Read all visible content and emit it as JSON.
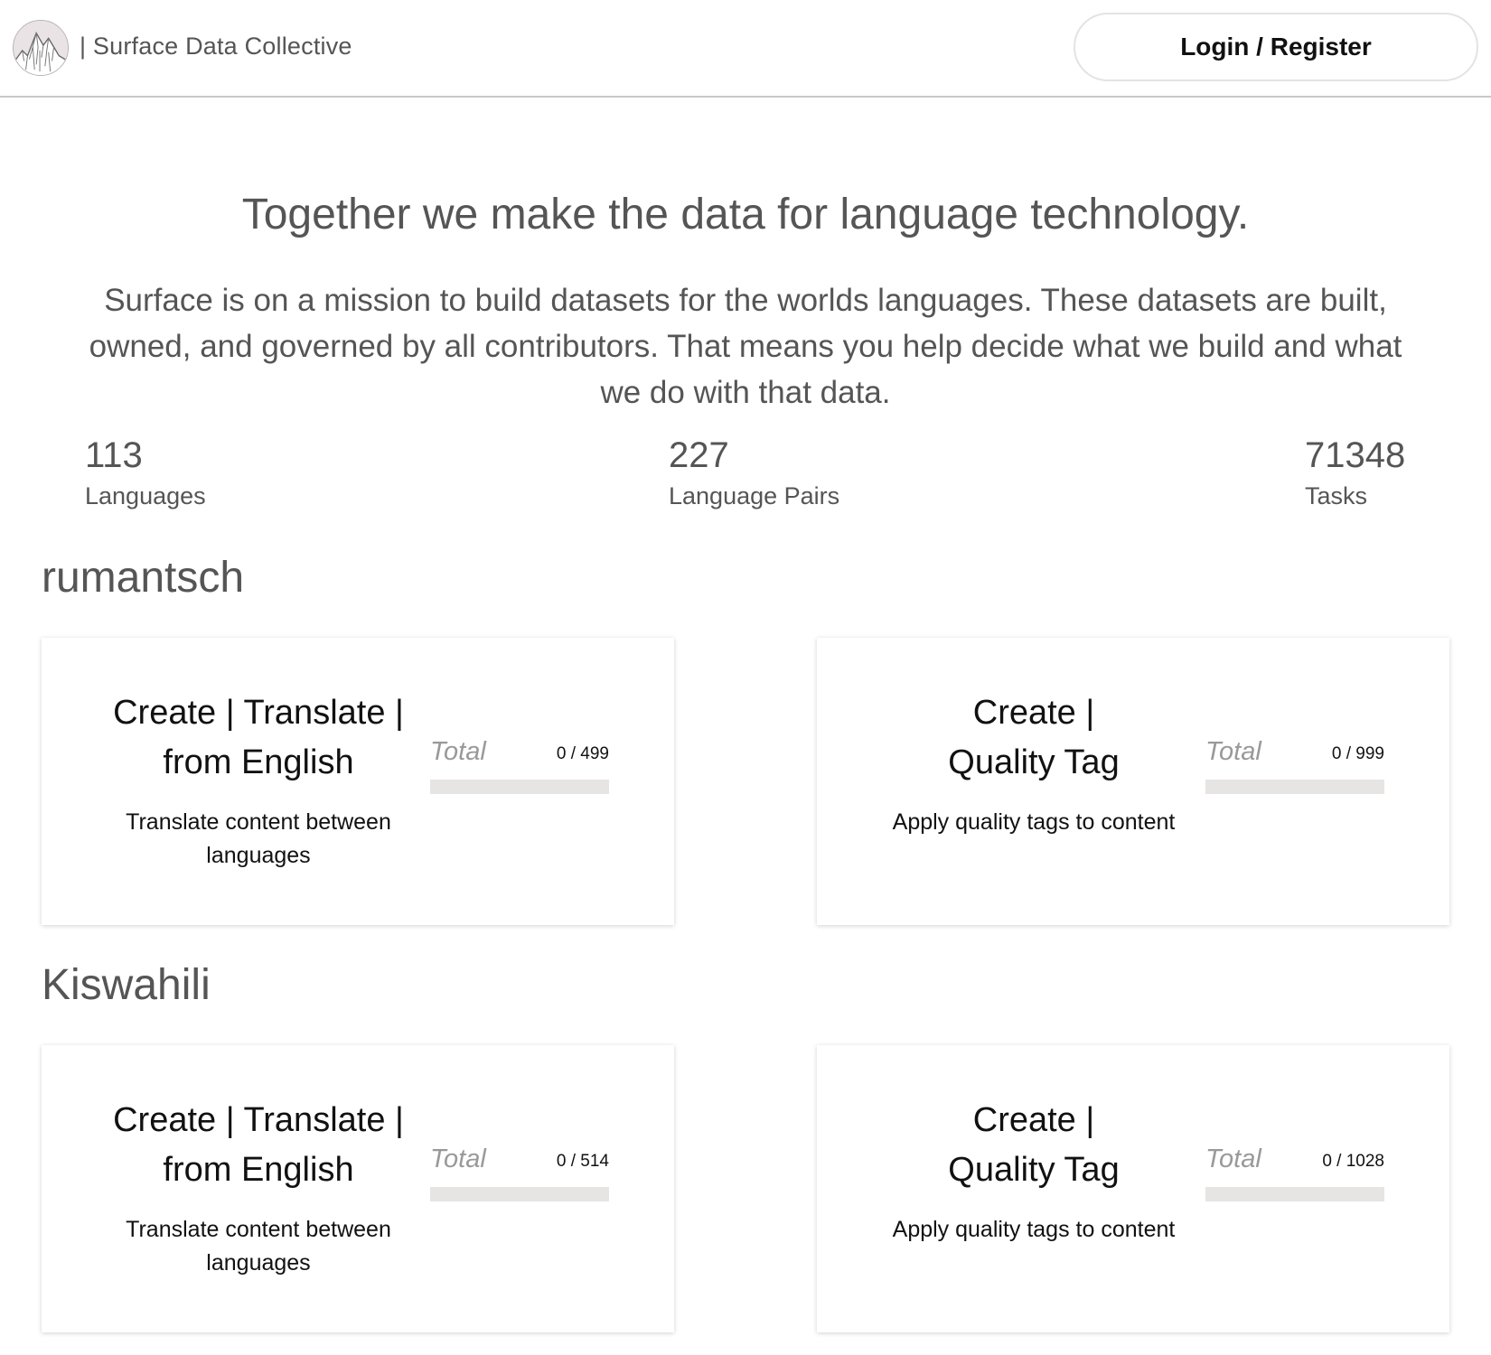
{
  "header": {
    "brand": "| Surface Data Collective",
    "login_label": "Login / Register"
  },
  "hero": {
    "title": "Together we make the data for language technology.",
    "description": "Surface is on a mission to build datasets for the worlds languages. These datasets are built, owned, and governed by all contributors. That means you help decide what we build and what we do with that data."
  },
  "stats": [
    {
      "value": "113",
      "label": "Languages"
    },
    {
      "value": "227",
      "label": "Language Pairs"
    },
    {
      "value": "71348",
      "label": "Tasks"
    }
  ],
  "sections": [
    {
      "title": "rumantsch",
      "cards": [
        {
          "title": "Create | Translate | from English",
          "description": "Translate content between languages",
          "progress_label": "Total",
          "progress_text": "0 / 499",
          "progress_fraction": 0
        },
        {
          "title": "Create | Quality Tag",
          "description": "Apply quality tags to content",
          "progress_label": "Total",
          "progress_text": "0 / 999",
          "progress_fraction": 0
        }
      ]
    },
    {
      "title": "Kiswahili",
      "cards": [
        {
          "title": "Create | Translate | from English",
          "description": "Translate content between languages",
          "progress_label": "Total",
          "progress_text": "0 / 514",
          "progress_fraction": 0
        },
        {
          "title": "Create | Quality Tag",
          "description": "Apply quality tags to content",
          "progress_label": "Total",
          "progress_text": "0 / 1028",
          "progress_fraction": 0
        }
      ]
    }
  ],
  "icons": {
    "logo": "mountain-logo-icon"
  }
}
